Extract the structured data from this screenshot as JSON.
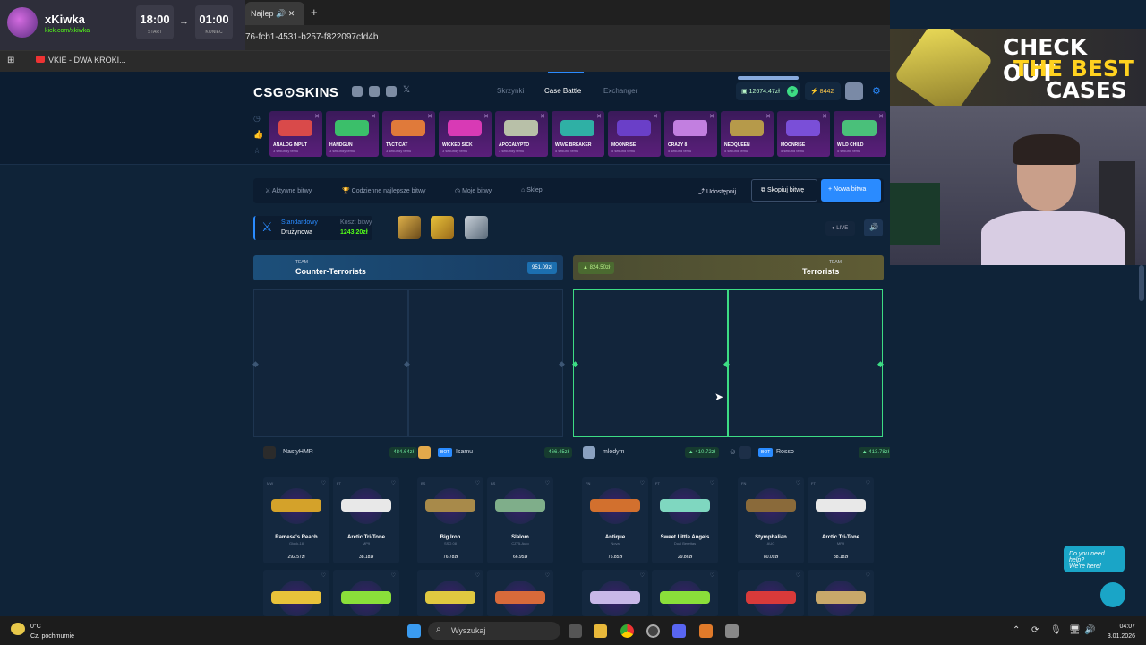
{
  "stream": {
    "name": "xKiwka",
    "url": "kick.com/xkiwka",
    "start_time": "18:00",
    "start_label": "START",
    "end_time": "01:00",
    "end_label": "KONIEC"
  },
  "browser": {
    "tab_title": "Najlep",
    "address": "76-fcb1-4531-b257-f822097cfd4b",
    "bookmark": "VKIE - DWA KROKI..."
  },
  "site": {
    "logo": "CSG⊙SKINS",
    "nav": [
      "Skrzynki",
      "Case Battle",
      "Exchanger"
    ],
    "active_nav": "Case Battle",
    "balance": "12674.47zł",
    "coins": "8442",
    "drops": [
      {
        "name": "ANALOG INPUT",
        "sub": "3 sekundy temu",
        "color": "#d94a4a"
      },
      {
        "name": "HANDGUN",
        "sub": "3 sekundy temu",
        "color": "#3bbf6a"
      },
      {
        "name": "TACTICAT",
        "sub": "3 sekundy temu",
        "color": "#e07a3a"
      },
      {
        "name": "WICKED SICK",
        "sub": "3 sekundy temu",
        "color": "#d83ab5"
      },
      {
        "name": "APOCALYPTO",
        "sub": "3 sekundy temu",
        "color": "#b8c0a8"
      },
      {
        "name": "WAVE BREAKER",
        "sub": "5 sekund temu",
        "color": "#2fb0a5"
      },
      {
        "name": "MOONRISE",
        "sub": "5 sekund temu",
        "color": "#6a3fc8"
      },
      {
        "name": "CRAZY 8",
        "sub": "5 sekund temu",
        "color": "#c27fe0"
      },
      {
        "name": "NEOQUEEN",
        "sub": "5 sekund temu",
        "color": "#b69a4a"
      },
      {
        "name": "MOONRISE",
        "sub": "5 sekund temu",
        "color": "#7a4fd8"
      },
      {
        "name": "WILD CHILD",
        "sub": "5 sekund temu",
        "color": "#4ac07a"
      }
    ],
    "toolbar": {
      "active": "Aktywne bitwy",
      "daily": "Codzienne najlepsze bitwy",
      "mine": "Moje bitwy",
      "shop": "Sklep",
      "share": "Udostępnij",
      "copy": "Skopiuj bitwę",
      "new": "+ Nowa bitwa"
    },
    "battle": {
      "mode": "Standardowy",
      "team_mode": "Drużynowa",
      "cost_label": "Koszt bitwy",
      "cost": "1243.20zł",
      "live": "LIVE"
    },
    "teams": {
      "ct": {
        "small": "TEAM",
        "name": "Counter-Terrorists",
        "value": "951.09zł"
      },
      "t": {
        "small": "TEAM",
        "name": "Terrorists",
        "value": "▲ 824.50zł"
      }
    },
    "players": [
      {
        "name": "NastyHMR",
        "bot": false,
        "value": "484.64zł",
        "avatar": "#2b2b2b"
      },
      {
        "name": "Isamu",
        "bot": true,
        "bot_label": "BOT",
        "value": "466.45zł",
        "avatar": "#e3a94b"
      },
      {
        "name": "mlodym",
        "bot": false,
        "value": "▲ 410.72zł",
        "avatar": "#8aa1c0"
      },
      {
        "name": "Rosso",
        "bot": true,
        "bot_label": "BOT",
        "value": "▲ 413.78zł",
        "avatar": "#1d2f48"
      }
    ],
    "cards": [
      {
        "cond": "MW",
        "name": "Ramese's Reach",
        "sub": "Glock-18",
        "price": "292.57zł",
        "color": "#d4a22a"
      },
      {
        "cond": "FT",
        "name": "Arctic Tri-Tone",
        "sub": "MP9",
        "price": "38.18zł",
        "color": "#e8e8e8"
      },
      {
        "cond": "BS",
        "name": "Big Iron",
        "sub": "SSG 08",
        "price": "76.78zł",
        "color": "#a88a4a"
      },
      {
        "cond": "BS",
        "name": "Slalom",
        "sub": "CZ75-Auto",
        "price": "66.95zł",
        "color": "#7fae8a"
      },
      {
        "cond": "FN",
        "name": "Antique",
        "sub": "Nova",
        "price": "75.85zł",
        "color": "#d2702e"
      },
      {
        "cond": "FT",
        "name": "Sweet Little Angels",
        "sub": "Dual Berettas",
        "price": "29.86zł",
        "color": "#7fd7c0"
      },
      {
        "cond": "FN",
        "name": "Stymphalian",
        "sub": "AUG",
        "price": "80.09zł",
        "color": "#8a6a3a"
      },
      {
        "cond": "FT",
        "name": "Arctic Tri-Tone",
        "sub": "MP9",
        "price": "38.18zł",
        "color": "#e8e8e8"
      }
    ],
    "row2_colors": [
      "#e8c23a",
      "#8adf3a",
      "#e0c840",
      "#d86a3a",
      "#c8b8e8",
      "#8adf3a",
      "#d83a3a",
      "#c8a86a"
    ]
  },
  "ad": {
    "line1": "CHECK OUT",
    "line2": "THE BEST",
    "line3": "CASES"
  },
  "help": {
    "line1": "Do you need help?",
    "line2": "We're here!"
  },
  "taskbar": {
    "temp": "0°C",
    "weather": "Cz. pochmurnie",
    "search": "Wyszukaj",
    "time": "04:07",
    "date": "3.01.2026"
  }
}
